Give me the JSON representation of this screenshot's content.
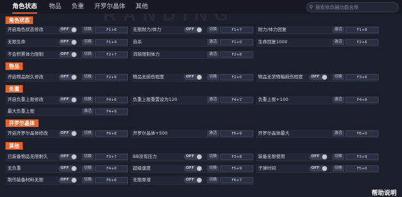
{
  "watermark": "RANDING",
  "tabs": [
    {
      "label": "角色状态"
    },
    {
      "label": "物品"
    },
    {
      "label": "负重"
    },
    {
      "label": "开罗尔晶体"
    },
    {
      "label": "其他"
    }
  ],
  "search": {
    "placeholder": "搜索修改器功能名称"
  },
  "toggle_text": "OFF",
  "sections": [
    {
      "title": "角色状态"
    },
    {
      "title": "物品"
    },
    {
      "title": "负重"
    },
    {
      "title": "开罗尔晶体"
    },
    {
      "title": "其他"
    }
  ],
  "cheats": [
    {
      "label": "开启角色状态修改",
      "action": "切换",
      "key": "F1+6"
    },
    {
      "label": "无限耐力/体力",
      "action": "切换",
      "key": "F1+7"
    },
    {
      "label": "耐力/体力回复",
      "action": "激活",
      "key": "F1+8"
    },
    {
      "label": "无限生命",
      "action": "切换",
      "key": "F1+4"
    },
    {
      "label": "自杀",
      "action": "激活",
      "key": "F1+0"
    },
    {
      "label": "生命回复1000",
      "action": "激活",
      "key": "F2+6"
    },
    {
      "label": "不会积累体力限制",
      "action": "切换",
      "key": "F2+7"
    },
    {
      "label": "消除限制体力",
      "action": "激活",
      "key": "F2+8"
    },
    {
      "label": "开启物品耐久修改",
      "action": "切换",
      "key": "F2+9"
    },
    {
      "label": "物品无损伤程度",
      "action": "切换",
      "key": "F2+0"
    },
    {
      "label": "物品无货物箱损伤程度",
      "action": "切换",
      "key": "F3+6"
    },
    {
      "label": "开启负重上限修改",
      "action": "切换",
      "key": "F4+6"
    },
    {
      "label": "负重上限重置设为120",
      "action": "激活",
      "key": "F4+7"
    },
    {
      "label": "负重上限+100",
      "action": "激活",
      "key": "F4+8"
    },
    {
      "label": "最大负重上限",
      "action": "激活",
      "key": "F4+9"
    },
    {
      "label": "开启开罗尔晶体修改",
      "action": "切换",
      "key": "F6+8"
    },
    {
      "label": "开罗尔晶体+500",
      "action": "激活",
      "key": "F6+9"
    },
    {
      "label": "开罗尔晶体最大",
      "action": "激活",
      "key": "F6+0"
    },
    {
      "label": "已装备物品无限耐久",
      "action": "切换",
      "key": "F3+7"
    },
    {
      "label": "BB没有压力",
      "action": "切换",
      "key": "F3+8"
    },
    {
      "label": "装备无限使用",
      "action": "切换",
      "key": "F3+9"
    },
    {
      "label": "无负重",
      "action": "切换",
      "key": "F4+0"
    },
    {
      "label": "超级速度",
      "action": "切换",
      "key": "F5+9"
    },
    {
      "label": "子弹时间",
      "action": "切换",
      "key": "F5+0"
    },
    {
      "label": "制作装备材料无限",
      "action": "切换",
      "key": "F6+6"
    },
    {
      "label": "无限尿液",
      "action": "切换",
      "key": "F6+7"
    }
  ],
  "help_label": "帮助说明"
}
